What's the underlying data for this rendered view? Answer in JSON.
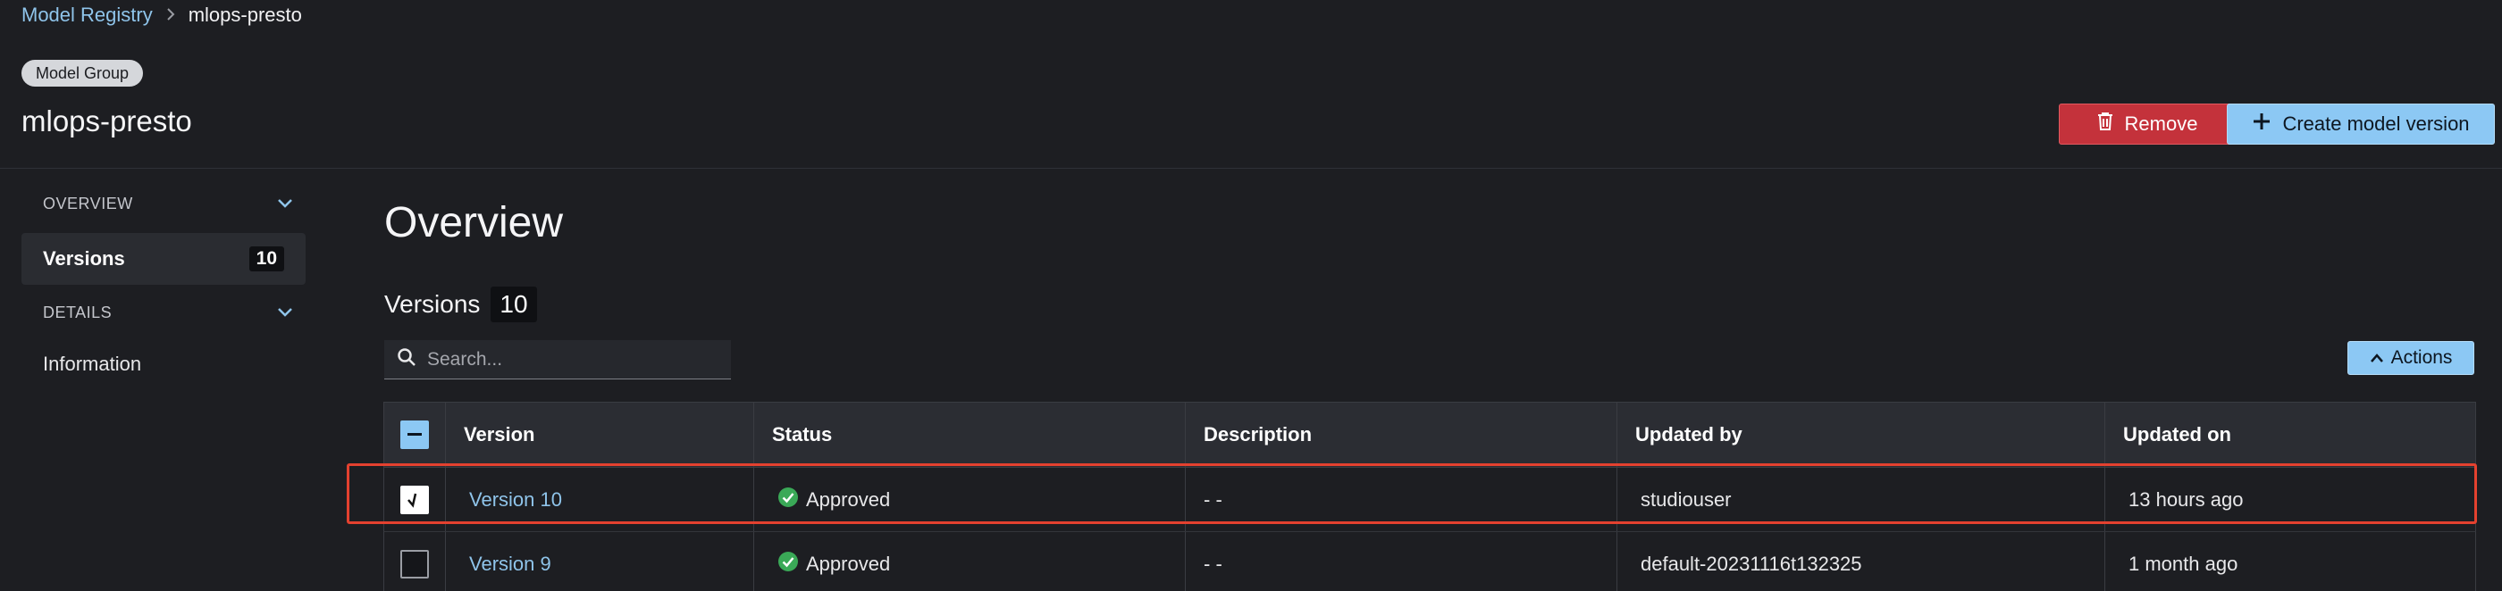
{
  "breadcrumb": {
    "parent": "Model Registry",
    "separator": ">",
    "current": "mlops-presto"
  },
  "header": {
    "badge": "Model Group",
    "title": "mlops-presto",
    "remove_label": "Remove",
    "create_label": "Create model version"
  },
  "sidebar": {
    "overview_label": "OVERVIEW",
    "versions_label": "Versions",
    "versions_count": "10",
    "details_label": "DETAILS",
    "information_label": "Information"
  },
  "main": {
    "title": "Overview",
    "versions_heading": "Versions",
    "versions_count": "10",
    "search_placeholder": "Search...",
    "actions_label": "Actions"
  },
  "table": {
    "columns": [
      "Version",
      "Status",
      "Description",
      "Updated by",
      "Updated on"
    ],
    "rows": [
      {
        "version": "Version 10",
        "status": "Approved",
        "description": "- -",
        "updated_by": "studiouser",
        "updated_on": "13 hours ago",
        "checked": true
      },
      {
        "version": "Version 9",
        "status": "Approved",
        "description": "- -",
        "updated_by": "default-20231116t132325",
        "updated_on": "1 month ago",
        "checked": false
      }
    ]
  },
  "colors": {
    "accent": "#8cc8f4",
    "danger": "#c4323b",
    "approved": "#3aa957",
    "highlight": "#e4412f"
  }
}
